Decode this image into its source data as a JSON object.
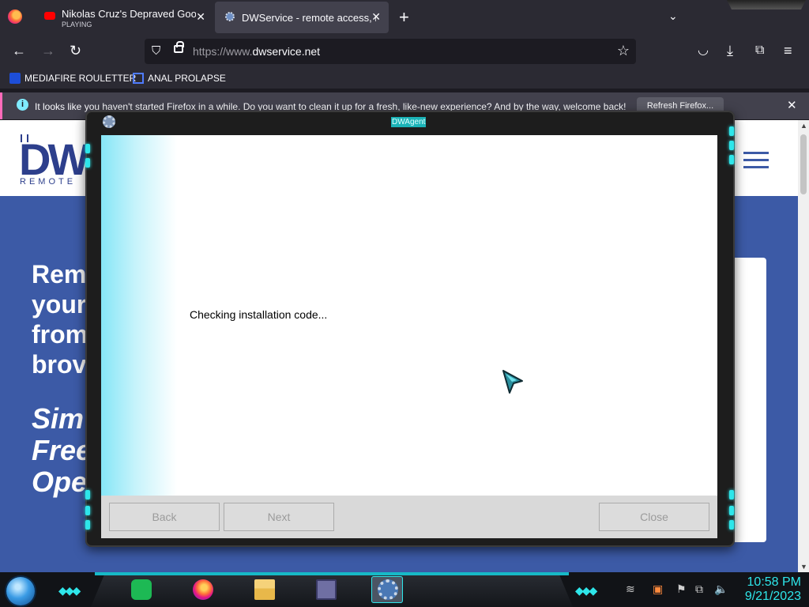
{
  "browser": {
    "tabs": [
      {
        "title": "Nikolas Cruz's Depraved Google",
        "subtitle": "PLAYING",
        "favicon": "youtube-icon"
      },
      {
        "title": "DWService - remote access, rem",
        "favicon": "dwservice-gear-icon"
      }
    ],
    "url_prefix": "https://www.",
    "url_domain": "dwservice.net",
    "bookmarks": [
      {
        "label": "MEDIAFIRE ROULETTER",
        "icon": "mediafire-icon"
      },
      {
        "label": "ANAL PROLAPSE",
        "icon": "bookmark-sigma-icon"
      }
    ],
    "infobar": {
      "message": "It looks like you haven't started Firefox in a while. Do you want to clean it up for a fresh, like-new experience? And by the way, welcome back!",
      "button": "Refresh Firefox..."
    }
  },
  "website": {
    "logo_text": "DW",
    "logo_tagline": "REMOTE",
    "hero_lines": [
      "Rem",
      "your",
      "from",
      "brov"
    ],
    "hero_italic": [
      "Sim",
      "Free",
      "Ope"
    ]
  },
  "dialog": {
    "title": "DWAgent",
    "status": "Checking installation code...",
    "buttons": {
      "back": "Back",
      "next": "Next",
      "close": "Close"
    }
  },
  "taskbar": {
    "time": "10:58 PM",
    "date": "9/21/2023"
  },
  "colors": {
    "accent_cyan": "#2ee6ea",
    "site_blue": "#3c5aa6",
    "firefox_dark": "#2b2a33"
  }
}
